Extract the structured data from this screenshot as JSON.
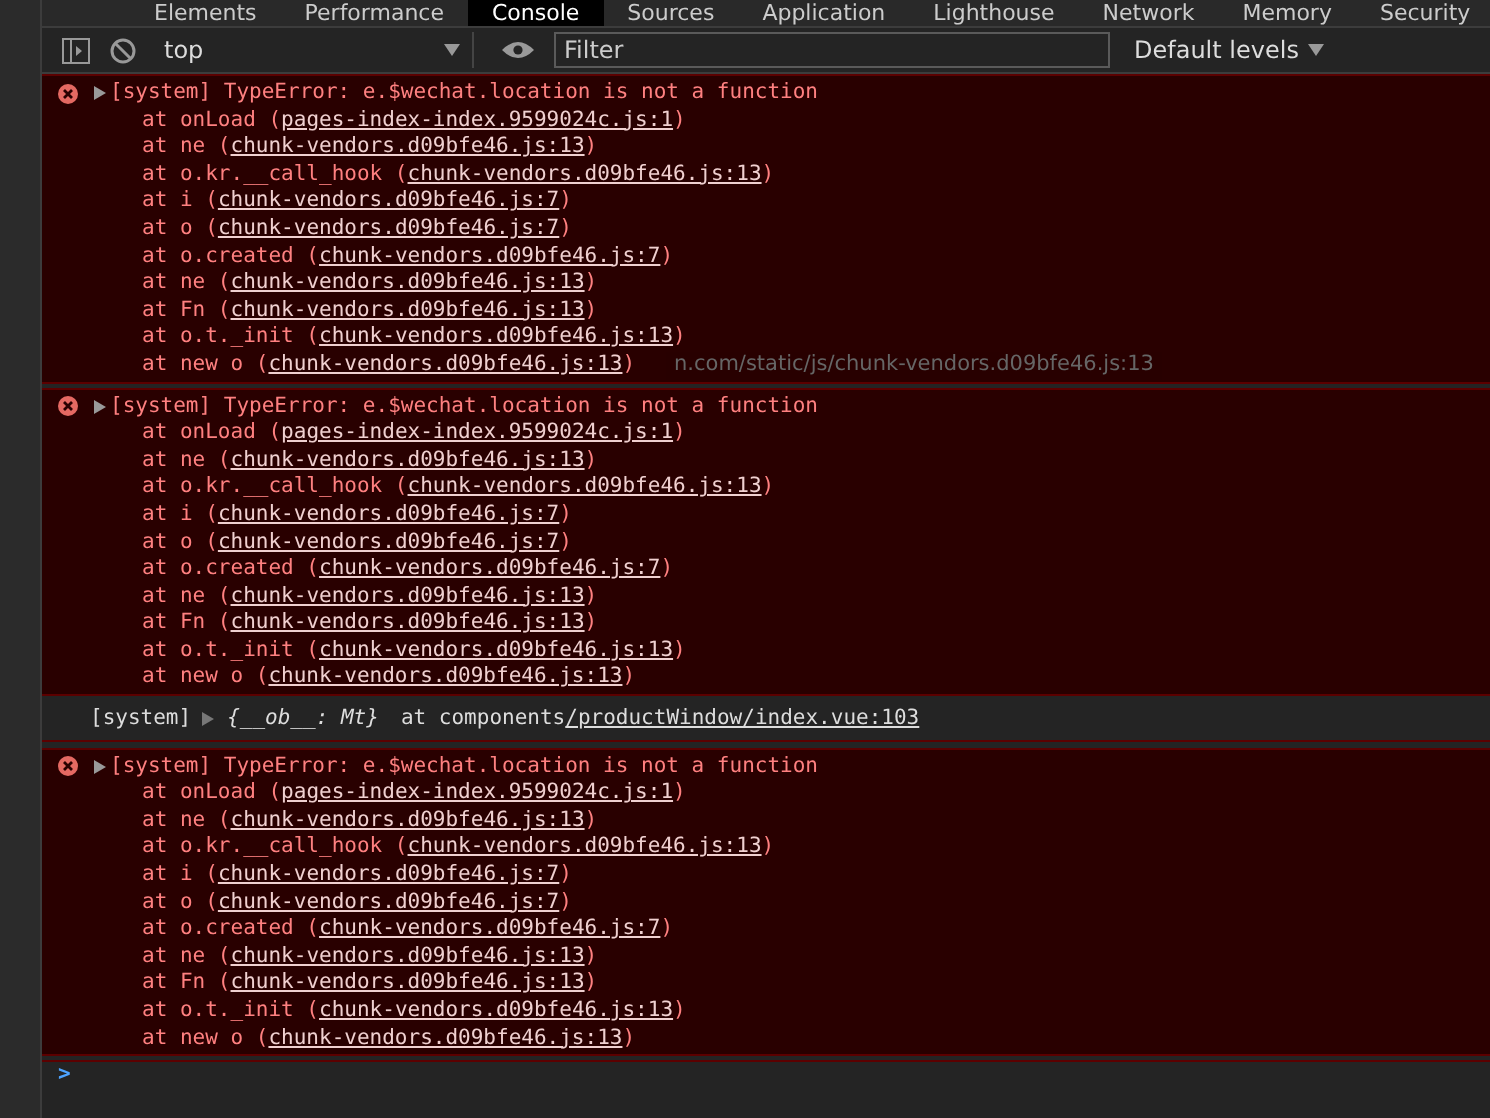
{
  "tabs": [
    {
      "label": "Elements",
      "selected": false
    },
    {
      "label": "Performance",
      "selected": false
    },
    {
      "label": "Console",
      "selected": true
    },
    {
      "label": "Sources",
      "selected": false
    },
    {
      "label": "Application",
      "selected": false
    },
    {
      "label": "Lighthouse",
      "selected": false
    },
    {
      "label": "Network",
      "selected": false
    },
    {
      "label": "Memory",
      "selected": false
    },
    {
      "label": "Security",
      "selected": false
    }
  ],
  "toolbar": {
    "context": "top",
    "filter": {
      "placeholder": "Filter"
    },
    "levels": "Default levels"
  },
  "messages": [
    {
      "kind": "error",
      "expanded": false,
      "text": "[system] TypeError: e.$wechat.location is not a function",
      "frames": [
        {
          "call": "at onLoad (",
          "link": "pages-index-index.9599024c.js:1",
          "end": ")"
        },
        {
          "call": "at ne (",
          "link": "chunk-vendors.d09bfe46.js:13",
          "end": ")"
        },
        {
          "call": "at o.kr.__call_hook (",
          "link": "chunk-vendors.d09bfe46.js:13",
          "end": ")"
        },
        {
          "call": "at i (",
          "link": "chunk-vendors.d09bfe46.js:7",
          "end": ")"
        },
        {
          "call": "at o (",
          "link": "chunk-vendors.d09bfe46.js:7",
          "end": ")"
        },
        {
          "call": "at o.created (",
          "link": "chunk-vendors.d09bfe46.js:7",
          "end": ")"
        },
        {
          "call": "at ne (",
          "link": "chunk-vendors.d09bfe46.js:13",
          "end": ")"
        },
        {
          "call": "at Fn (",
          "link": "chunk-vendors.d09bfe46.js:13",
          "end": ")"
        },
        {
          "call": "at o.t._init (",
          "link": "chunk-vendors.d09bfe46.js:13",
          "end": ")"
        },
        {
          "call": "at new o (",
          "link": "chunk-vendors.d09bfe46.js:13",
          "end": ")",
          "tooltip": "n.com/static/js/chunk-vendors.d09bfe46.js:13"
        }
      ]
    },
    {
      "kind": "error",
      "expanded": false,
      "text": "[system] TypeError: e.$wechat.location is not a function",
      "frames": [
        {
          "call": "at onLoad (",
          "link": "pages-index-index.9599024c.js:1",
          "end": ")"
        },
        {
          "call": "at ne (",
          "link": "chunk-vendors.d09bfe46.js:13",
          "end": ")"
        },
        {
          "call": "at o.kr.__call_hook (",
          "link": "chunk-vendors.d09bfe46.js:13",
          "end": ")"
        },
        {
          "call": "at i (",
          "link": "chunk-vendors.d09bfe46.js:7",
          "end": ")"
        },
        {
          "call": "at o (",
          "link": "chunk-vendors.d09bfe46.js:7",
          "end": ")"
        },
        {
          "call": "at o.created (",
          "link": "chunk-vendors.d09bfe46.js:7",
          "end": ")"
        },
        {
          "call": "at ne (",
          "link": "chunk-vendors.d09bfe46.js:13",
          "end": ")"
        },
        {
          "call": "at Fn (",
          "link": "chunk-vendors.d09bfe46.js:13",
          "end": ")"
        },
        {
          "call": "at o.t._init (",
          "link": "chunk-vendors.d09bfe46.js:13",
          "end": ")"
        },
        {
          "call": "at new o (",
          "link": "chunk-vendors.d09bfe46.js:13",
          "end": ")"
        }
      ]
    },
    {
      "kind": "log",
      "expanded": false,
      "prefix": "[system]",
      "object": "{__ob__: Mt}",
      "at": "at components",
      "link": "/productWindow/index.vue:103"
    },
    {
      "kind": "error",
      "expanded": false,
      "text": "[system] TypeError: e.$wechat.location is not a function",
      "frames": [
        {
          "call": "at onLoad (",
          "link": "pages-index-index.9599024c.js:1",
          "end": ")"
        },
        {
          "call": "at ne (",
          "link": "chunk-vendors.d09bfe46.js:13",
          "end": ")"
        },
        {
          "call": "at o.kr.__call_hook (",
          "link": "chunk-vendors.d09bfe46.js:13",
          "end": ")"
        },
        {
          "call": "at i (",
          "link": "chunk-vendors.d09bfe46.js:7",
          "end": ")"
        },
        {
          "call": "at o (",
          "link": "chunk-vendors.d09bfe46.js:7",
          "end": ")"
        },
        {
          "call": "at o.created (",
          "link": "chunk-vendors.d09bfe46.js:7",
          "end": ")"
        },
        {
          "call": "at ne (",
          "link": "chunk-vendors.d09bfe46.js:13",
          "end": ")"
        },
        {
          "call": "at Fn (",
          "link": "chunk-vendors.d09bfe46.js:13",
          "end": ")"
        },
        {
          "call": "at o.t._init (",
          "link": "chunk-vendors.d09bfe46.js:13",
          "end": ")"
        },
        {
          "call": "at new o (",
          "link": "chunk-vendors.d09bfe46.js:13",
          "end": ")"
        }
      ]
    }
  ],
  "prompt": ">"
}
